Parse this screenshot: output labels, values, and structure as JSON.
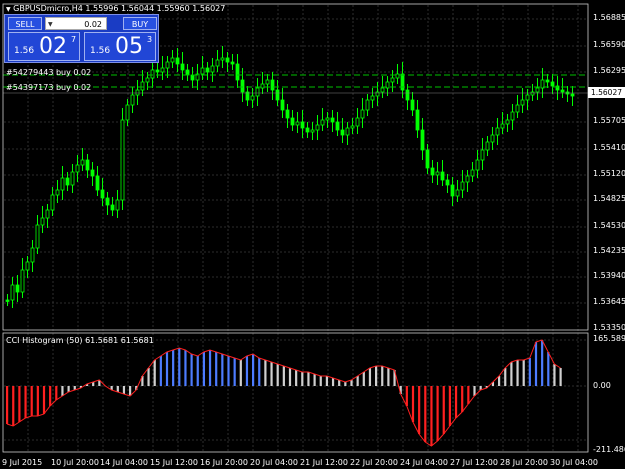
{
  "header": {
    "symbol_info": "GBPUSDmicro,H4  1.55996 1.56044 1.55960 1.56027"
  },
  "trade_panel": {
    "sell_label": "SELL",
    "buy_label": "BUY",
    "lot": "0.02",
    "sell_small": "1.56",
    "sell_big": "02",
    "sell_sup": "7",
    "buy_small": "1.56",
    "buy_big": "05",
    "buy_sup": "3"
  },
  "orders": [
    {
      "label": "#54279443 buy 0.02"
    },
    {
      "label": "#54397173 buy 0.02"
    }
  ],
  "price_axis": {
    "ticks": [
      "1.56885",
      "1.56590",
      "1.56295",
      "1.56027",
      "1.55705",
      "1.55410",
      "1.55120",
      "1.54825",
      "1.54530",
      "1.54235",
      "1.53940",
      "1.53645",
      "1.53350"
    ],
    "current": "1.56027"
  },
  "indicator": {
    "title": "CCI Histogram (50) 61.5681 61.5681",
    "ticks": [
      "165.5893",
      "0.00",
      "-211.4867"
    ]
  },
  "time_axis": {
    "labels": [
      "9 Jul 2015",
      "10 Jul 20:00",
      "14 Jul 04:00",
      "15 Jul 12:00",
      "16 Jul 20:00",
      "20 Jul 04:00",
      "21 Jul 12:00",
      "22 Jul 20:00",
      "24 Jul 04:00",
      "27 Jul 12:00",
      "28 Jul 20:00",
      "30 Jul 04:00"
    ]
  },
  "colors": {
    "bull": "#00ff00",
    "bear": "#00ff00",
    "grid": "#3a3a3a",
    "hist_red": "#ff2020",
    "hist_white": "#d0d0d0",
    "hist_blue": "#4d7cff"
  }
}
